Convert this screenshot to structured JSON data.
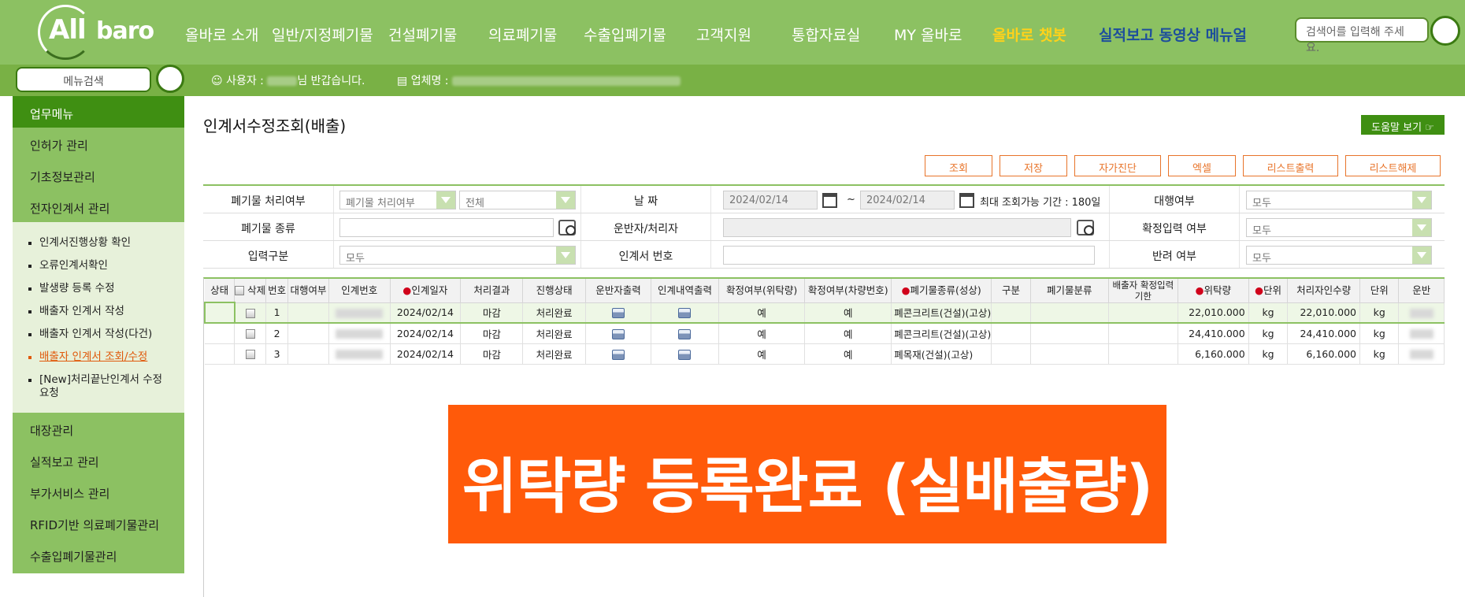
{
  "brand": {
    "logo_all": "All",
    "logo_baro": "baro"
  },
  "top_nav": {
    "items": [
      "올바로 소개",
      "일반/지정폐기물",
      "건설폐기물",
      "의료폐기물",
      "수출입폐기물",
      "고객지원",
      "통합자료실",
      "MY 올바로"
    ],
    "chatbot": "올바로 챗봇",
    "video_manual": "실적보고 동영상 메뉴얼",
    "search_placeholder": "검색어를 입력해 주세요."
  },
  "subbar": {
    "menu_search": "메뉴검색",
    "user_label": "사용자 :",
    "user_greeting": "님 반갑습니다.",
    "company_label": "업체명 :"
  },
  "sidebar": {
    "header": "업무메뉴",
    "top_items": [
      "인허가 관리",
      "기초정보관리",
      "전자인계서 관리"
    ],
    "sub_items": [
      "인계서진행상황 확인",
      "오류인계서확인",
      "발생량 등록 수정",
      "배출자 인계서 작성",
      "배출자 인계서 작성(다건)",
      "배출자 인계서 조회/수정",
      "[New]처리끝난인계서 수정요청"
    ],
    "active_sub": "배출자 인계서 조회/수정",
    "bottom_items": [
      "대장관리",
      "실적보고 관리",
      "부가서비스 관리",
      "RFID기반 의료폐기물관리",
      "수출입폐기물관리"
    ]
  },
  "page": {
    "title": "인계서수정조회(배출)",
    "help": "도움말 보기",
    "actions": [
      "조회",
      "저장",
      "자가진단",
      "엑셀",
      "리스트출력",
      "리스트해제"
    ]
  },
  "form": {
    "waste_process_label": "폐기물 처리여부",
    "waste_process_value": "폐기물 처리여부",
    "waste_process_all": "전체",
    "date_label": "날 짜",
    "date_from": "2024/02/14",
    "date_sep": "~",
    "date_to": "2024/02/14",
    "date_note": "최대 조회가능 기간 : 180일",
    "agency_label": "대행여부",
    "agency_value": "모두",
    "waste_type_label": "폐기물 종류",
    "carrier_label": "운반자/처리자",
    "confirm_input_label": "확정입력 여부",
    "confirm_input_value": "모두",
    "input_type_label": "입력구분",
    "input_type_value": "모두",
    "slip_no_label": "인계서 번호",
    "return_label": "반려 여부",
    "return_value": "모두"
  },
  "grid": {
    "headers": [
      "상태",
      "삭제",
      "번호",
      "대행여부",
      "인계번호",
      "인계일자",
      "처리결과",
      "진행상태",
      "운반자출력",
      "인계내역출력",
      "확정여부(위탁량)",
      "확정여부(차량번호)",
      "폐기물종류(성상)",
      "구분",
      "폐기물분류",
      "배출자 확정입력기한",
      "위탁량",
      "단위",
      "처리자인수량",
      "단위",
      "운반"
    ],
    "rows": [
      {
        "no": "1",
        "date": "2024/02/14",
        "result": "마감",
        "status": "처리완료",
        "confirm_amt": "예",
        "confirm_car": "예",
        "waste": "폐콘크리트(건설)(고상)",
        "amount": "22,010.000",
        "unit": "kg",
        "recv": "22,010.000",
        "unit2": "kg"
      },
      {
        "no": "2",
        "date": "2024/02/14",
        "result": "마감",
        "status": "처리완료",
        "confirm_amt": "예",
        "confirm_car": "예",
        "waste": "폐콘크리트(건설)(고상)",
        "amount": "24,410.000",
        "unit": "kg",
        "recv": "24,410.000",
        "unit2": "kg"
      },
      {
        "no": "3",
        "date": "2024/02/14",
        "result": "마감",
        "status": "처리완료",
        "confirm_amt": "예",
        "confirm_car": "예",
        "waste": "폐목재(건설)(고상)",
        "amount": "6,160.000",
        "unit": "kg",
        "recv": "6,160.000",
        "unit2": "kg"
      }
    ]
  },
  "banner": {
    "text": "위탁량 등록완료 (실배출량)"
  },
  "colors": {
    "brand_green": "#8cc162",
    "dark_green": "#3f8f12",
    "accent_orange": "#ff5a0a",
    "chatbot_gold": "#ffd21a",
    "manual_blue": "#1d4e9c"
  }
}
